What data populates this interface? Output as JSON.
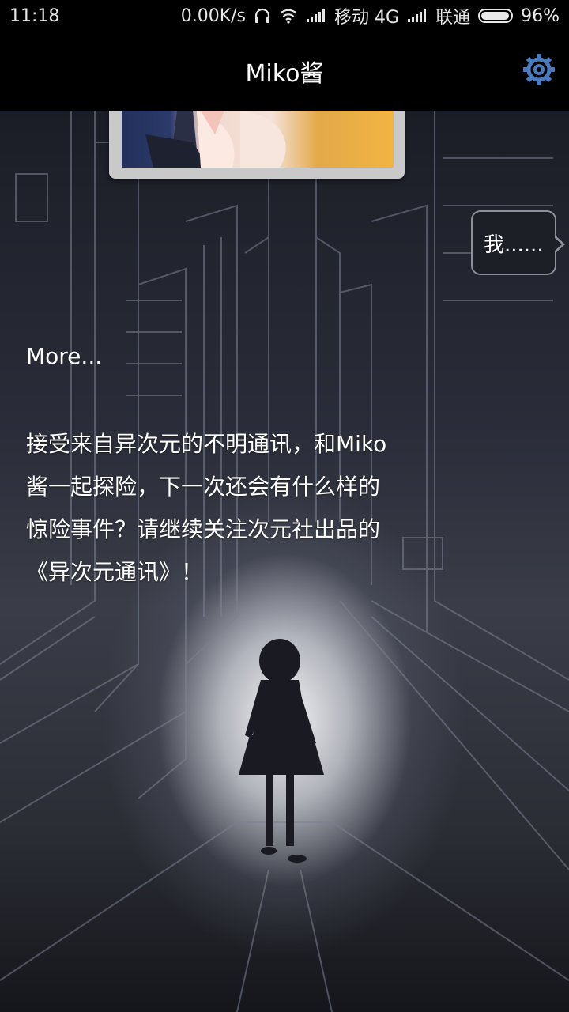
{
  "status_bar": {
    "time": "11:18",
    "net_speed": "0.00K/s",
    "carrier1": "移动 4G",
    "carrier2": "联通",
    "battery_percent": "96%",
    "battery_level": 0.96,
    "icons": [
      "headphones-icon",
      "wifi-icon",
      "signal-icon",
      "signal-icon",
      "battery-icon"
    ]
  },
  "app_bar": {
    "title": "Miko酱",
    "settings_icon": "gear-icon",
    "accent_color": "#4a7bbf"
  },
  "chat": {
    "bubble_text": "我......",
    "more_label": "More...",
    "story_lines": [
      "接受来自异次元的不明通讯，和Miko",
      "酱一起探险，下一次还会有什么样的",
      "惊险事件？请继续关注次元社出品的",
      "《异次元通讯》！"
    ]
  }
}
